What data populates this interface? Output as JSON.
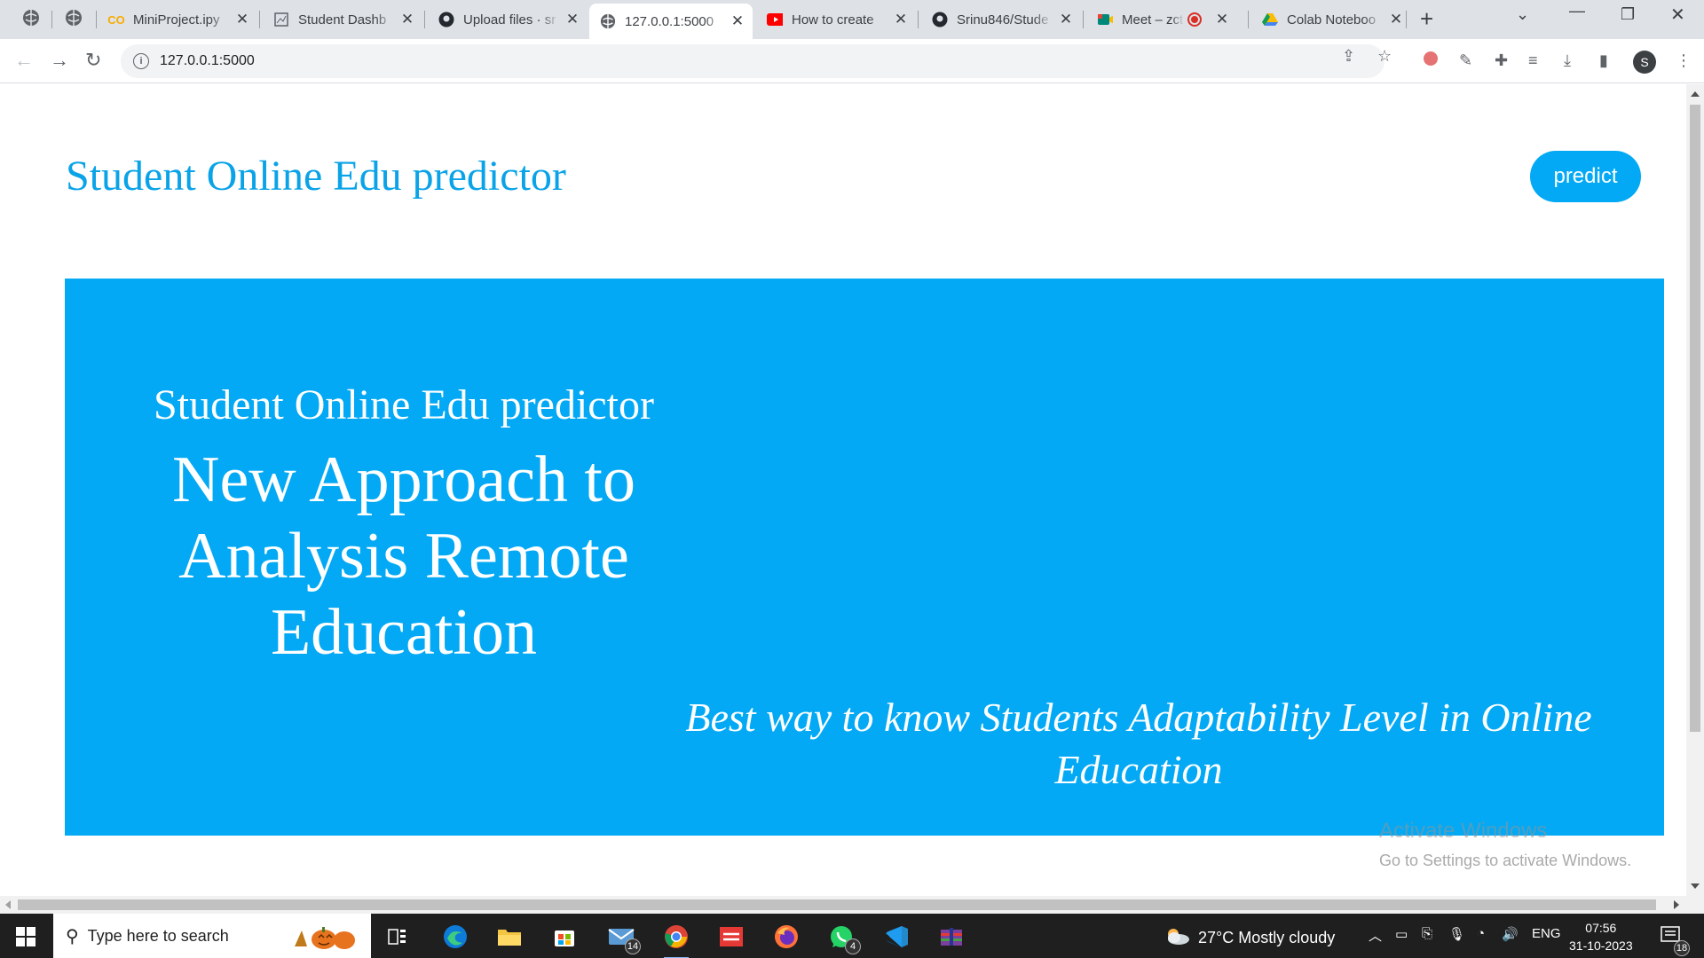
{
  "browser": {
    "tabs": [
      {
        "label": "MiniProject.ipy",
        "icon": "colab-icon"
      },
      {
        "label": "Student Dashb",
        "icon": "dashboard-icon"
      },
      {
        "label": "Upload files · sr",
        "icon": "github-icon"
      },
      {
        "label": "127.0.0.1:5000",
        "icon": "globe-icon",
        "active": true
      },
      {
        "label": "How to create",
        "icon": "youtube-icon"
      },
      {
        "label": "Srinu846/Stude",
        "icon": "github-icon"
      },
      {
        "label": "Meet – zct",
        "icon": "meet-icon"
      },
      {
        "label": "Colab Noteboo",
        "icon": "drive-icon"
      }
    ],
    "url": "127.0.0.1:5000",
    "profile_initial": "S"
  },
  "page": {
    "site_title": "Student Online Edu predictor",
    "predict_button": "predict",
    "hero": {
      "subtitle": "Student Online Edu predictor",
      "heading": "New Approach to Analysis Remote Education",
      "tagline": "Best way to know Students Adaptability Level in Online Education"
    },
    "accent_color": "#03a9f4"
  },
  "watermark": {
    "line1": "Activate Windows",
    "line2": "Go to Settings to activate Windows."
  },
  "taskbar": {
    "search_placeholder": "Type here to search",
    "mail_badge": "14",
    "whatsapp_badge": "4",
    "weather": "27°C  Mostly cloudy",
    "language": "ENG",
    "time": "07:56",
    "date": "31-10-2023",
    "notification_count": "18"
  }
}
